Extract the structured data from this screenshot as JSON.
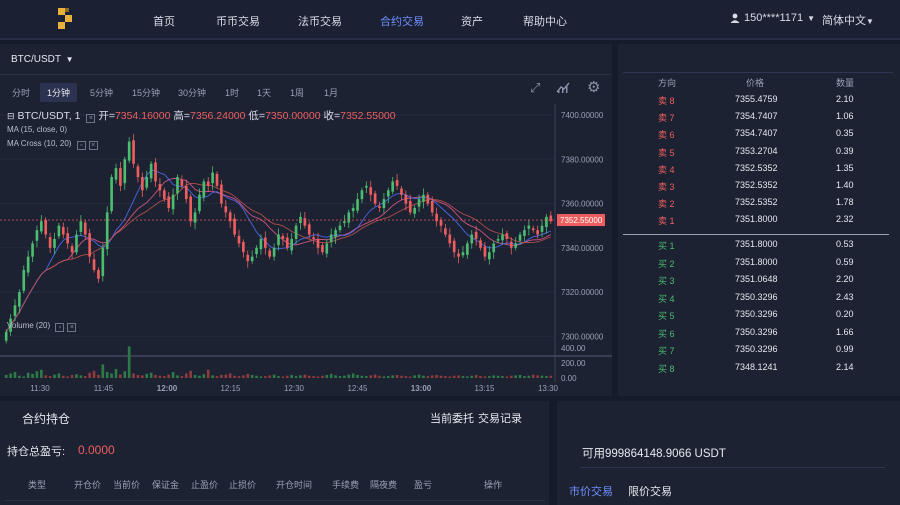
{
  "nav": {
    "items": [
      "首页",
      "币币交易",
      "法币交易",
      "合约交易",
      "资产",
      "帮助中心"
    ],
    "active_index": 3,
    "user": "150****1171",
    "language": "简体中文",
    "accent": "#6f8fff"
  },
  "chart_toolbar": {
    "pair": "BTC/USDT",
    "intervals": [
      "分时",
      "1分钟",
      "5分钟",
      "15分钟",
      "30分钟",
      "1时",
      "1天",
      "1周",
      "1月"
    ],
    "active_interval": "1分钟"
  },
  "legend": {
    "symbol": "BTC/USDT, 1",
    "open_label": "开=",
    "open": "7354.16000",
    "high_label": "高=",
    "high": "7356.24000",
    "low_label": "低=",
    "low": "7350.00000",
    "close_label": "收=",
    "close": "7352.55000",
    "ma": "MA (15, close, 0)",
    "ma_cross": "MA Cross (10, 20)",
    "volume": "Volume (20)"
  },
  "chart_data": {
    "type": "candlestick",
    "price_ticks": [
      "7400.00000",
      "7380.00000",
      "7360.00000",
      "7340.00000",
      "7320.00000",
      "7300.00000"
    ],
    "price_range": [
      7292,
      7405
    ],
    "last_price": "7352.55000",
    "volume_ticks": [
      "400.00",
      "200.00",
      "0.00"
    ],
    "volume_range": [
      0,
      450
    ],
    "time_ticks": [
      "11:30",
      "11:45",
      "12:00",
      "12:15",
      "12:30",
      "12:45",
      "13:00",
      "13:15",
      "13:30"
    ],
    "closes": [
      7302,
      7308,
      7314,
      7320,
      7330,
      7336,
      7342,
      7348,
      7352,
      7346,
      7340,
      7344,
      7350,
      7346,
      7342,
      7338,
      7346,
      7352,
      7346,
      7336,
      7330,
      7326,
      7340,
      7356,
      7372,
      7376,
      7368,
      7380,
      7388,
      7378,
      7372,
      7366,
      7372,
      7378,
      7370,
      7366,
      7362,
      7358,
      7364,
      7372,
      7368,
      7362,
      7352,
      7356,
      7364,
      7370,
      7368,
      7374,
      7368,
      7360,
      7356,
      7352,
      7346,
      7342,
      7338,
      7334,
      7336,
      7340,
      7344,
      7340,
      7336,
      7340,
      7346,
      7344,
      7340,
      7344,
      7350,
      7354,
      7350,
      7346,
      7344,
      7340,
      7338,
      7342,
      7346,
      7348,
      7350,
      7352,
      7356,
      7358,
      7362,
      7366,
      7368,
      7364,
      7360,
      7358,
      7362,
      7366,
      7370,
      7368,
      7364,
      7360,
      7356,
      7358,
      7362,
      7364,
      7360,
      7356,
      7352,
      7350,
      7346,
      7342,
      7338,
      7336,
      7338,
      7342,
      7346,
      7344,
      7340,
      7336,
      7338,
      7342,
      7344,
      7346,
      7344,
      7340,
      7342,
      7346,
      7348,
      7350,
      7348,
      7346,
      7350,
      7354,
      7352
    ],
    "volumes": [
      40,
      60,
      80,
      30,
      20,
      70,
      55,
      90,
      110,
      35,
      25,
      45,
      60,
      30,
      20,
      40,
      50,
      35,
      25,
      70,
      95,
      40,
      180,
      80,
      60,
      120,
      45,
      90,
      420,
      60,
      40,
      35,
      55,
      70,
      40,
      30,
      25,
      45,
      80,
      35,
      25,
      60,
      95,
      40,
      30,
      50,
      110,
      35,
      25,
      40,
      45,
      60,
      30,
      25,
      35,
      55,
      40,
      30,
      20,
      25,
      35,
      45,
      25,
      20,
      30,
      40,
      25,
      35,
      45,
      30,
      25,
      20,
      30,
      40,
      55,
      35,
      25,
      30,
      45,
      60,
      40,
      30,
      25,
      35,
      45,
      30,
      20,
      25,
      35,
      40,
      30,
      25,
      20,
      35,
      45,
      30,
      25,
      35,
      40,
      30,
      25,
      20,
      30,
      35,
      25,
      20,
      30,
      40,
      25,
      20,
      25,
      35,
      30,
      25,
      20,
      30,
      35,
      40,
      25,
      30,
      45,
      35,
      30,
      25,
      30
    ]
  },
  "colors": {
    "up": "#4bbd6e",
    "down": "#ee5e5e",
    "ma": "#e05a8a",
    "cross_fast": "#4f6ef7",
    "cross_slow": "#c0524e"
  },
  "orderbook": {
    "headers": [
      "方向",
      "价格",
      "数量"
    ],
    "asks": [
      {
        "side": "卖 8",
        "price": "7355.4759",
        "qty": "2.10"
      },
      {
        "side": "卖 7",
        "price": "7354.7407",
        "qty": "1.06"
      },
      {
        "side": "卖 6",
        "price": "7354.7407",
        "qty": "0.35"
      },
      {
        "side": "卖 5",
        "price": "7353.2704",
        "qty": "0.39"
      },
      {
        "side": "卖 4",
        "price": "7352.5352",
        "qty": "1.35"
      },
      {
        "side": "卖 3",
        "price": "7352.5352",
        "qty": "1.40"
      },
      {
        "side": "卖 2",
        "price": "7352.5352",
        "qty": "1.78"
      },
      {
        "side": "卖 1",
        "price": "7351.8000",
        "qty": "2.32"
      }
    ],
    "bids": [
      {
        "side": "买 1",
        "price": "7351.8000",
        "qty": "0.53"
      },
      {
        "side": "买 2",
        "price": "7351.8000",
        "qty": "0.59"
      },
      {
        "side": "买 3",
        "price": "7351.0648",
        "qty": "2.20"
      },
      {
        "side": "买 4",
        "price": "7350.3296",
        "qty": "2.43"
      },
      {
        "side": "买 5",
        "price": "7350.3296",
        "qty": "0.20"
      },
      {
        "side": "买 6",
        "price": "7350.3296",
        "qty": "1.66"
      },
      {
        "side": "买 7",
        "price": "7350.3296",
        "qty": "0.99"
      },
      {
        "side": "买 8",
        "price": "7348.1241",
        "qty": "2.14"
      }
    ]
  },
  "positions": {
    "title": "合约持仓",
    "tab_orders": "当前委托",
    "tab_trades": "交易记录",
    "pnl_label": "持仓总盈亏:",
    "pnl_value": "0.0000",
    "columns": [
      "类型",
      "开仓价",
      "当前价",
      "保证金",
      "止盈价",
      "止损价",
      "开仓时间",
      "手续费",
      "隔夜费",
      "盈亏",
      "操作"
    ]
  },
  "trade": {
    "available": "可用999864148.9066 USDT",
    "tab_market": "市价交易",
    "tab_limit": "限价交易"
  }
}
